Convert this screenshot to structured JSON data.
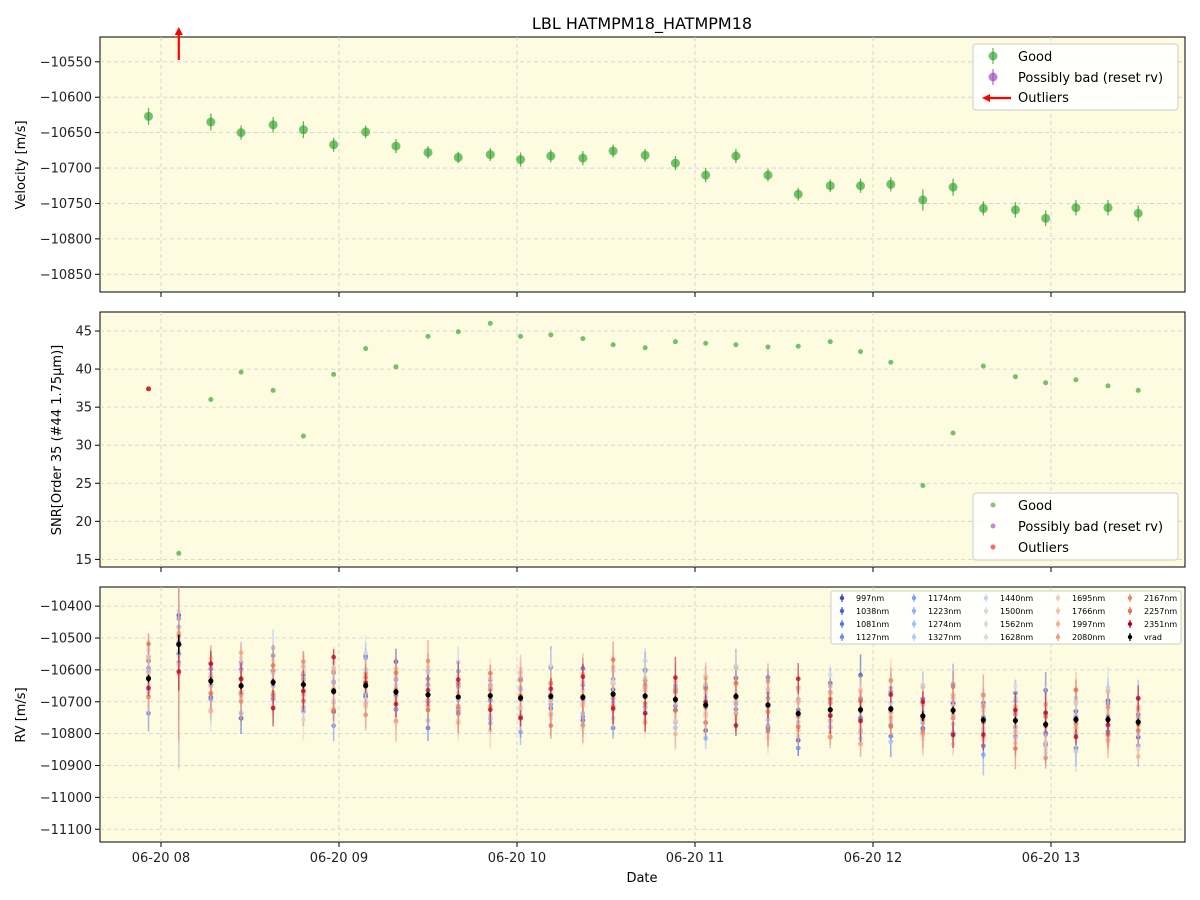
{
  "title": "LBL HATMPM18_HATMPM18",
  "xlabel": "Date",
  "x_ticks": [
    "06-20 08",
    "06-20 09",
    "06-20 10",
    "06-20 11",
    "06-20 12",
    "06-20 13"
  ],
  "colors": {
    "background": "#fdfbe0",
    "good": "#2ca02c",
    "possibly_bad": "#9b3fb5",
    "outliers": "#ff0000",
    "vrad": "#000000",
    "grid": "#cfcfcf"
  },
  "chart_data": [
    {
      "type": "scatter",
      "panel": "velocity",
      "ylabel": "Velocity [m/s]",
      "ylim": [
        -10875,
        -10515
      ],
      "y_ticks": [
        -10550,
        -10600,
        -10650,
        -10700,
        -10750,
        -10800,
        -10850
      ],
      "grid": true,
      "legend_placement": "top-right",
      "legend": [
        "Good",
        "Possibly bad (reset rv)",
        "Outliers"
      ],
      "x": [
        "07:56",
        "08:27",
        "08:45",
        "08:56",
        "09:06",
        "09:18",
        "09:28",
        "09:38",
        "09:48",
        "09:58",
        "10:08",
        "10:18",
        "10:28",
        "10:38",
        "10:48",
        "10:58",
        "11:08",
        "11:18",
        "11:28",
        "11:38",
        "11:48",
        "11:58",
        "12:08",
        "12:18",
        "12:28",
        "12:38",
        "12:48",
        "12:58",
        "13:08",
        "13:18"
      ],
      "x_hours": [
        7.93,
        8.28,
        8.45,
        8.63,
        8.8,
        8.97,
        9.15,
        9.32,
        9.5,
        9.67,
        9.85,
        10.02,
        10.19,
        10.37,
        10.54,
        10.72,
        10.89,
        11.06,
        11.23,
        11.41,
        11.58,
        11.76,
        11.93,
        12.1,
        12.28,
        12.45,
        12.62,
        12.8,
        12.97,
        13.14,
        13.32,
        13.49
      ],
      "series": [
        {
          "name": "Good",
          "y": [
            -10627,
            -10635,
            -10650,
            -10639,
            -10646,
            -10667,
            -10649,
            -10669,
            -10678,
            -10685,
            -10681,
            -10688,
            -10683,
            -10686,
            -10676,
            -10682,
            -10693,
            -10710,
            -10683,
            -10710,
            -10737,
            -10725,
            -10725,
            -10723,
            -10745,
            -10727,
            -10757,
            -10759,
            -10771,
            -10756,
            -10756,
            -10764
          ],
          "err": [
            12,
            12,
            10,
            11,
            12,
            10,
            9,
            10,
            9,
            8,
            9,
            10,
            9,
            10,
            9,
            9,
            10,
            10,
            10,
            9,
            9,
            9,
            10,
            10,
            15,
            12,
            10,
            11,
            11,
            11,
            11,
            11
          ]
        },
        {
          "name": "Outliers",
          "x_hours": [
            8.1
          ],
          "y": [
            -10523
          ],
          "note_arrow": "off-scale upward"
        }
      ]
    },
    {
      "type": "scatter",
      "panel": "snr",
      "ylabel": "SNR[Order 35 (#44 1.75μm)]",
      "ylim": [
        14,
        47.5
      ],
      "y_ticks": [
        15,
        20,
        25,
        30,
        35,
        40,
        45
      ],
      "grid": true,
      "legend_placement": "bottom-right",
      "legend": [
        "Good",
        "Possibly bad (reset rv)",
        "Outliers"
      ],
      "series": [
        {
          "name": "Good",
          "x_hours": [
            8.1,
            8.28,
            8.45,
            8.63,
            8.8,
            8.97,
            9.15,
            9.32,
            9.5,
            9.67,
            9.85,
            10.02,
            10.19,
            10.37,
            10.54,
            10.72,
            10.89,
            11.06,
            11.23,
            11.41,
            11.58,
            11.76,
            11.93,
            12.1,
            12.28,
            12.45,
            12.62,
            12.8,
            12.97,
            13.14,
            13.32,
            13.49
          ],
          "y": [
            15.8,
            36.0,
            39.6,
            37.2,
            31.2,
            39.3,
            42.7,
            40.3,
            44.3,
            44.9,
            46.0,
            44.3,
            44.5,
            44.0,
            43.2,
            42.8,
            43.6,
            43.4,
            43.2,
            42.9,
            43.0,
            43.6,
            42.3,
            40.9,
            24.7,
            31.6,
            40.4,
            39.0,
            38.2,
            38.6,
            37.8,
            37.2
          ]
        },
        {
          "name": "Outliers",
          "x_hours": [
            7.93
          ],
          "y": [
            37.4
          ]
        }
      ]
    },
    {
      "type": "scatter",
      "panel": "rv_per_band",
      "ylabel": "RV [m/s]",
      "ylim": [
        -11140,
        -10340
      ],
      "y_ticks": [
        -10400,
        -10500,
        -10600,
        -10700,
        -10800,
        -10900,
        -11000,
        -11100
      ],
      "grid": true,
      "legend_placement": "top-right",
      "bands": [
        "997nm",
        "1038nm",
        "1081nm",
        "1127nm",
        "1174nm",
        "1223nm",
        "1274nm",
        "1327nm",
        "1440nm",
        "1500nm",
        "1562nm",
        "1628nm",
        "1695nm",
        "1766nm",
        "1997nm",
        "2080nm",
        "2167nm",
        "2257nm",
        "2351nm"
      ],
      "band_colors": [
        "#3b4cc0",
        "#4961d2",
        "#5977e3",
        "#6a8bef",
        "#7b9ff9",
        "#8db0fe",
        "#9ebeff",
        "#b0cbff",
        "#c0d4f5",
        "#cfdaea",
        "#dddcdc",
        "#e8d6cc",
        "#f1ccb8",
        "#f5c0a3",
        "#f7af91",
        "#f59c7d",
        "#ee8468",
        "#e46e56",
        "#b40426"
      ],
      "vrad_name": "vrad",
      "vrad_y": [
        -10627,
        -10520,
        -10635,
        -10650,
        -10639,
        -10646,
        -10667,
        -10649,
        -10669,
        -10678,
        -10685,
        -10681,
        -10688,
        -10683,
        -10686,
        -10676,
        -10682,
        -10693,
        -10710,
        -10683,
        -10710,
        -10737,
        -10725,
        -10725,
        -10723,
        -10745,
        -10727,
        -10757,
        -10759,
        -10771,
        -10756,
        -10756,
        -10764
      ],
      "vrad_x_hours": [
        7.93,
        8.1,
        8.28,
        8.45,
        8.63,
        8.8,
        8.97,
        9.15,
        9.32,
        9.5,
        9.67,
        9.85,
        10.02,
        10.19,
        10.37,
        10.54,
        10.72,
        10.89,
        11.06,
        11.23,
        11.41,
        11.58,
        11.76,
        11.93,
        12.1,
        12.28,
        12.45,
        12.62,
        12.8,
        12.97,
        13.14,
        13.32,
        13.49
      ],
      "vrad_err": [
        12,
        30,
        12,
        10,
        11,
        12,
        10,
        9,
        10,
        9,
        8,
        9,
        10,
        9,
        10,
        9,
        9,
        10,
        10,
        10,
        9,
        9,
        9,
        10,
        10,
        15,
        12,
        10,
        11,
        11,
        11,
        11,
        11
      ],
      "band_spread_m_s": 110
    }
  ]
}
